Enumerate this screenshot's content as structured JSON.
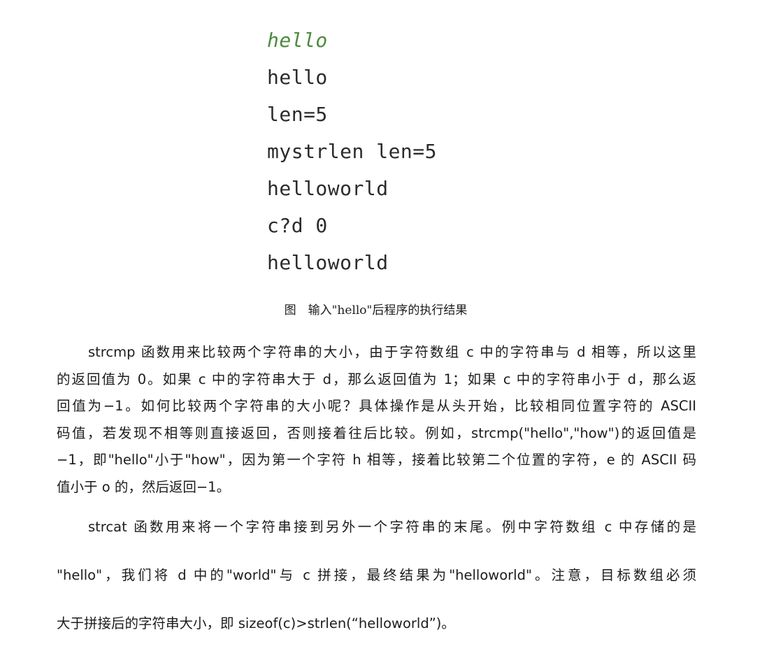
{
  "console_output": [
    "hello",
    "hello",
    "len=5",
    "mystrlen len=5",
    "helloworld",
    "c?d 0",
    "helloworld"
  ],
  "caption": "图　输入\"hello\"后程序的执行结果",
  "paragraph1": [
    "strcmp 函数用来比较两个字符串的大小，由于字符数组 c 中的字符串与 d 相等，所以这里",
    "的返回值为 0。如果 c 中的字符串大于 d，那么返回值为 1；如果 c 中的字符串小于 d，那么返",
    "回值为−1。如何比较两个字符串的大小呢？具体操作是从头开始，比较相同位置字符的 ASCII",
    "码值，若发现不相等则直接返回，否则接着往后比较。例如，strcmp(\"hello\",\"how\")的返回值是",
    "−1，即\"hello\"小于\"how\"，因为第一个字符 h 相等，接着比较第二个位置的字符，e 的 ASCII 码",
    "值小于 o 的，然后返回−1。"
  ],
  "paragraph2": [
    "strcat 函数用来将一个字符串接到另外一个字符串的末尾。例中字符数组 c 中存储的是",
    "\"hello\"，我们将 d 中的\"world\"与 c 拼接，最终结果为\"helloworld\"。注意，目标数组必须",
    "大于拼接后的字符串大小，即 sizeof(c)>strlen(“helloworld”)。"
  ]
}
